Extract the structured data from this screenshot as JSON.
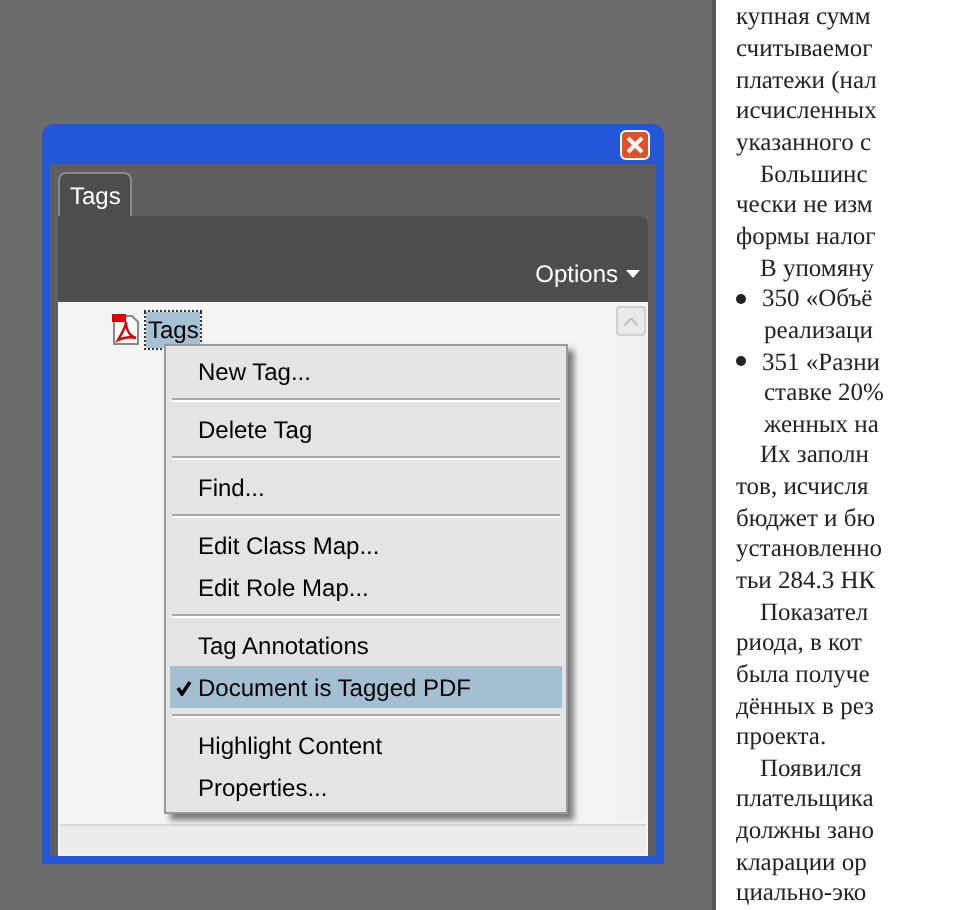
{
  "panel": {
    "tab": {
      "label": "Tags",
      "selected": true
    },
    "options": "Options",
    "tree": [
      {
        "label": "Tags",
        "selected": true
      }
    ]
  },
  "context_menu": {
    "groups": [
      [
        {
          "label": "New Tag...",
          "checked": false,
          "selected": false
        }
      ],
      [
        {
          "label": "Delete Tag",
          "checked": false,
          "selected": false
        }
      ],
      [
        {
          "label": "Find...",
          "checked": false,
          "selected": false
        }
      ],
      [
        {
          "label": "Edit Class Map...",
          "checked": false,
          "selected": false
        },
        {
          "label": "Edit Role Map...",
          "checked": false,
          "selected": false
        }
      ],
      [
        {
          "label": "Tag Annotations",
          "checked": false,
          "selected": false
        },
        {
          "label": "Document is Tagged PDF",
          "checked": true,
          "selected": true
        }
      ],
      [
        {
          "label": "Highlight Content",
          "checked": false,
          "selected": false
        },
        {
          "label": "Properties...",
          "checked": false,
          "selected": false
        }
      ]
    ]
  },
  "document": {
    "lines": [
      {
        "text": "купная сумм",
        "kind": "line"
      },
      {
        "text": "считываемог",
        "kind": "line"
      },
      {
        "text": "платежи (нал",
        "kind": "line"
      },
      {
        "text": "исчисленных",
        "kind": "line"
      },
      {
        "text": "указанного с",
        "kind": "line"
      },
      {
        "text": "Большинс",
        "kind": "indent"
      },
      {
        "text": "чески не изм",
        "kind": "line"
      },
      {
        "text": "формы налог",
        "kind": "line"
      },
      {
        "text": "В упомяну",
        "kind": "indent"
      },
      {
        "text": "350 «Объё",
        "kind": "bullet"
      },
      {
        "text": "реализаци",
        "kind": "hanging"
      },
      {
        "text": "351 «Разни",
        "kind": "bullet"
      },
      {
        "text": "ставке 20%",
        "kind": "hanging"
      },
      {
        "text": "женных на",
        "kind": "hanging"
      },
      {
        "text": "Их заполн",
        "kind": "indent"
      },
      {
        "text": "тов, исчисля",
        "kind": "line"
      },
      {
        "text": "бюджет и бю",
        "kind": "line"
      },
      {
        "text": "установленно",
        "kind": "line"
      },
      {
        "text": "тьи 284.3 НК",
        "kind": "line"
      },
      {
        "text": "Показател",
        "kind": "indent"
      },
      {
        "text": "риода, в кот",
        "kind": "line"
      },
      {
        "text": "была получе",
        "kind": "line"
      },
      {
        "text": "дённых в рез",
        "kind": "line"
      },
      {
        "text": "проекта.",
        "kind": "line"
      },
      {
        "text": "Появился",
        "kind": "indent"
      },
      {
        "text": "плательщика",
        "kind": "line"
      },
      {
        "text": "должны зано",
        "kind": "line"
      },
      {
        "text": "кларации ор",
        "kind": "line"
      },
      {
        "text": "циально-эко",
        "kind": "line"
      }
    ]
  }
}
